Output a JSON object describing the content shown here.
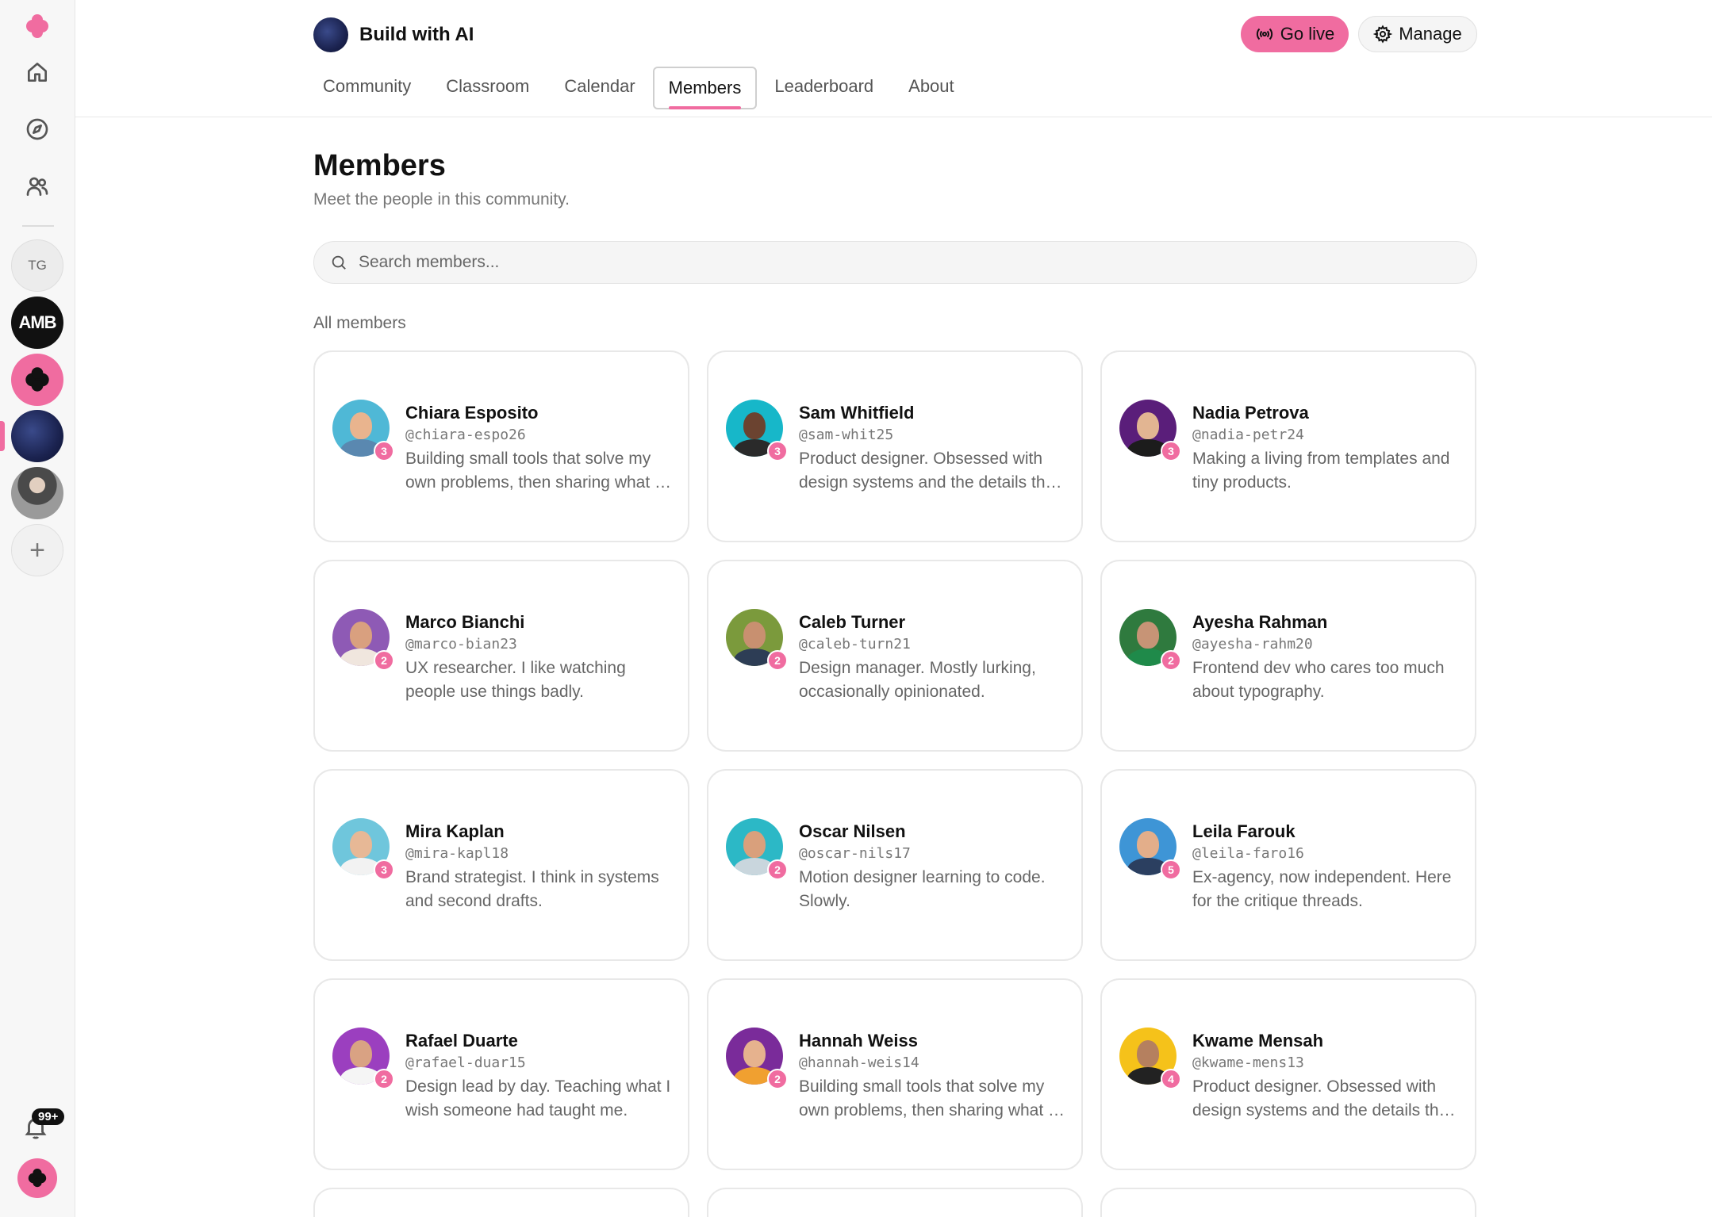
{
  "rail": {
    "items": [
      {
        "name": "logo-icon"
      },
      {
        "name": "home-icon"
      },
      {
        "name": "explore-icon"
      },
      {
        "name": "members-icon"
      }
    ],
    "communities": [
      {
        "label": "TG"
      },
      {
        "label": "AMB"
      },
      {
        "label": ""
      },
      {
        "label": ""
      },
      {
        "label": ""
      }
    ],
    "notifications_badge": "99+"
  },
  "header": {
    "title": "Build with AI",
    "go_live_label": "Go live",
    "manage_label": "Manage",
    "tabs": [
      {
        "label": "Community"
      },
      {
        "label": "Classroom"
      },
      {
        "label": "Calendar"
      },
      {
        "label": "Members",
        "active": true
      },
      {
        "label": "Leaderboard"
      },
      {
        "label": "About"
      }
    ]
  },
  "page": {
    "title": "Members",
    "subtitle": "Meet the people in this community.",
    "search_placeholder": "Search members...",
    "section_label": "All members"
  },
  "colors": {
    "accent": "#f06ca0"
  },
  "members": [
    {
      "name": "Chiara Esposito",
      "handle": "@chiara-espo26",
      "bio": "Building small tools that solve my own problems, then sharing what I learn along the way.",
      "level": "3",
      "bg": "#4fb8d6",
      "skin": "#e9b48e",
      "shirt": "#5a88b0"
    },
    {
      "name": "Sam Whitfield",
      "handle": "@sam-whit25",
      "bio": "Product designer. Obsessed with design systems and the details that make them work.",
      "level": "3",
      "bg": "#17b7c9",
      "skin": "#6b4330",
      "shirt": "#2a2a2a"
    },
    {
      "name": "Nadia Petrova",
      "handle": "@nadia-petr24",
      "bio": "Making a living from templates and tiny products.",
      "level": "3",
      "bg": "#5a1e7a",
      "skin": "#e2b592",
      "shirt": "#1c1c1c"
    },
    {
      "name": "Marco Bianchi",
      "handle": "@marco-bian23",
      "bio": "UX researcher. I like watching people use things badly.",
      "level": "2",
      "bg": "#8e5ab5",
      "skin": "#d9a07f",
      "shirt": "#f0e6de"
    },
    {
      "name": "Caleb Turner",
      "handle": "@caleb-turn21",
      "bio": "Design manager. Mostly lurking, occasionally opinionated.",
      "level": "2",
      "bg": "#7b9a3c",
      "skin": "#c89070",
      "shirt": "#2d3d55"
    },
    {
      "name": "Ayesha Rahman",
      "handle": "@ayesha-rahm20",
      "bio": "Frontend dev who cares too much about typography.",
      "level": "2",
      "bg": "#2f7a3e",
      "skin": "#c79476",
      "shirt": "#1f8a4a"
    },
    {
      "name": "Mira Kaplan",
      "handle": "@mira-kapl18",
      "bio": "Brand strategist. I think in systems and second drafts.",
      "level": "3",
      "bg": "#6fc6dc",
      "skin": "#e7b896",
      "shirt": "#f2f2f2"
    },
    {
      "name": "Oscar Nilsen",
      "handle": "@oscar-nils17",
      "bio": "Motion designer learning to code. Slowly.",
      "level": "2",
      "bg": "#2cb8c6",
      "skin": "#d9a07c",
      "shirt": "#c9d6dd"
    },
    {
      "name": "Leila Farouk",
      "handle": "@leila-faro16",
      "bio": "Ex-agency, now independent. Here for the critique threads.",
      "level": "5",
      "bg": "#3e95d6",
      "skin": "#e3ae8a",
      "shirt": "#2b3f60"
    },
    {
      "name": "Rafael Duarte",
      "handle": "@rafael-duar15",
      "bio": "Design lead by day. Teaching what I wish someone had taught me.",
      "level": "2",
      "bg": "#9b3fbf",
      "skin": "#d9a283",
      "shirt": "#f5f5f5"
    },
    {
      "name": "Hannah Weiss",
      "handle": "@hannah-weis14",
      "bio": "Building small tools that solve my own problems, then sharing what I learn along the way.",
      "level": "2",
      "bg": "#7a2b9a",
      "skin": "#e6b28e",
      "shirt": "#f0a030"
    },
    {
      "name": "Kwame Mensah",
      "handle": "@kwame-mens13",
      "bio": "Product designer. Obsessed with design systems and the details that make them work.",
      "level": "4",
      "bg": "#f5c21a",
      "skin": "#b5805f",
      "shirt": "#222222"
    }
  ]
}
